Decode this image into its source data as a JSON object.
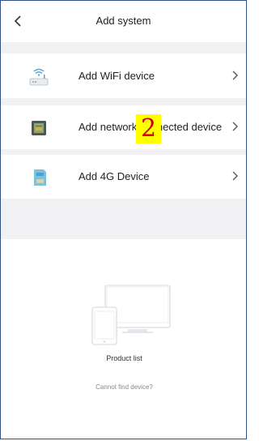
{
  "navbar": {
    "back_icon": "chevron-left-icon",
    "title": "Add system"
  },
  "devices": [
    {
      "label": "Add WiFi device",
      "icon": "wifi-router-icon"
    },
    {
      "label": "Add network connected device",
      "icon": "network-device-icon"
    },
    {
      "label": "Add 4G Device",
      "icon": "4g-sim-icon"
    }
  ],
  "annotation": {
    "label": "2"
  },
  "empty_state": {
    "graphic_icon": "devices-outline-icon",
    "product_list": "Product list",
    "cannot_find": "Cannot find device?"
  },
  "colors": {
    "background_gray": "#f1f1f3",
    "frame_border": "#2f4f8f",
    "annotation_bg": "#ffff00",
    "annotation_text": "#cc0000"
  }
}
